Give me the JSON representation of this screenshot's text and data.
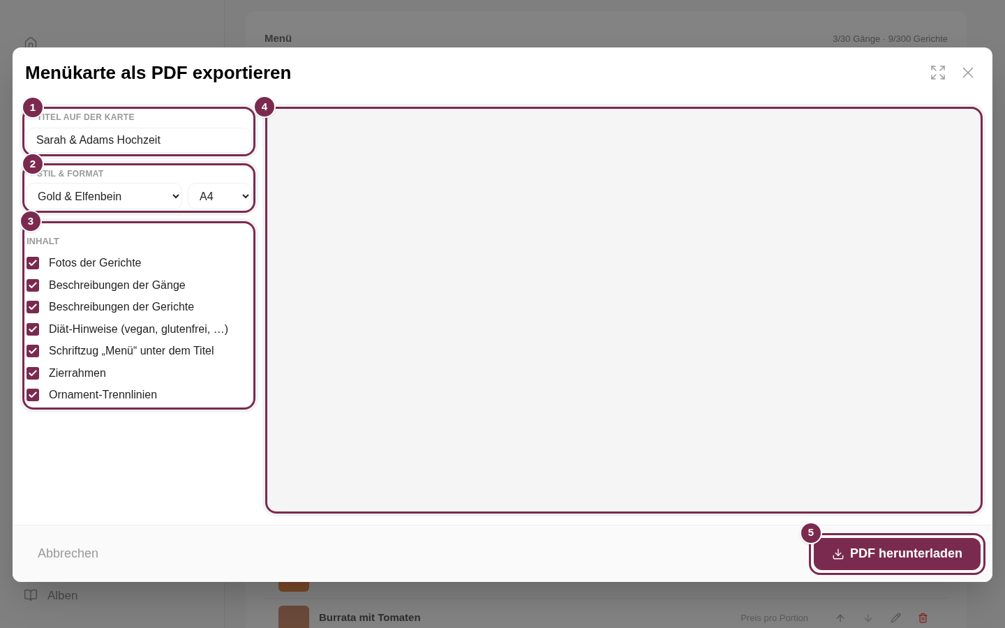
{
  "background": {
    "sidebar_items": [
      {
        "label": "Alben"
      }
    ],
    "header": {
      "title": "Menü",
      "counts": "3/30 Gänge · 9/300 Gerichte"
    },
    "rows": [
      {
        "name": "Burrata mit Tomaten",
        "price_label": "Preis pro Portion"
      }
    ]
  },
  "dialog": {
    "title": "Menükarte als PDF exportieren",
    "title_field": {
      "callout": "1",
      "label": "TITEL AUF DER KARTE",
      "value": "Sarah & Adams Hochzeit"
    },
    "style_format": {
      "callout": "2",
      "label": "STIL & FORMAT",
      "style": "Gold & Elfenbein",
      "format": "A4"
    },
    "content": {
      "callout": "3",
      "label": "INHALT",
      "options": [
        {
          "label": "Fotos der Gerichte",
          "checked": true
        },
        {
          "label": "Beschreibungen der Gänge",
          "checked": true
        },
        {
          "label": "Beschreibungen der Gerichte",
          "checked": true
        },
        {
          "label": "Diät-Hinweise (vegan, glutenfrei, …)",
          "checked": true
        },
        {
          "label": "Schriftzug „Menü“ unter dem Titel",
          "checked": true
        },
        {
          "label": "Zierrahmen",
          "checked": true
        },
        {
          "label": "Ornament-Trennlinien",
          "checked": true
        }
      ]
    },
    "preview": {
      "callout": "4"
    },
    "cancel": "Abbrechen",
    "download": {
      "callout": "5",
      "label": "PDF herunterladen"
    }
  }
}
